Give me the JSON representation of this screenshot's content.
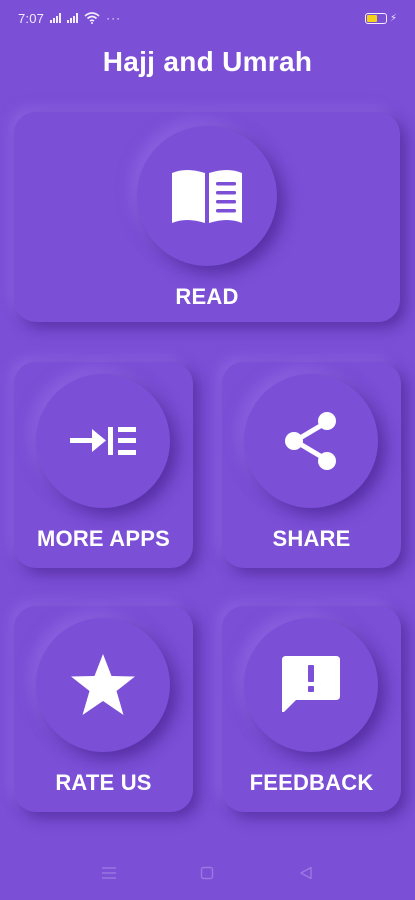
{
  "status_bar": {
    "time": "7:07",
    "dots": "···"
  },
  "app": {
    "title": "Hajj and Umrah"
  },
  "menu": {
    "read": {
      "label": "READ",
      "icon": "book-open-icon"
    },
    "more_apps": {
      "label": "MORE APPS",
      "icon": "arrow-into-list-icon"
    },
    "share": {
      "label": "SHARE",
      "icon": "share-icon"
    },
    "rate_us": {
      "label": "RATE US",
      "icon": "star-icon"
    },
    "feedback": {
      "label": "FEEDBACK",
      "icon": "feedback-icon"
    }
  },
  "colors": {
    "background": "#7B4FD6",
    "text": "#FFFFFF",
    "battery": "#F5D21A"
  },
  "nav_bar": {
    "buttons": [
      "menu-icon",
      "home-icon",
      "back-icon"
    ]
  }
}
